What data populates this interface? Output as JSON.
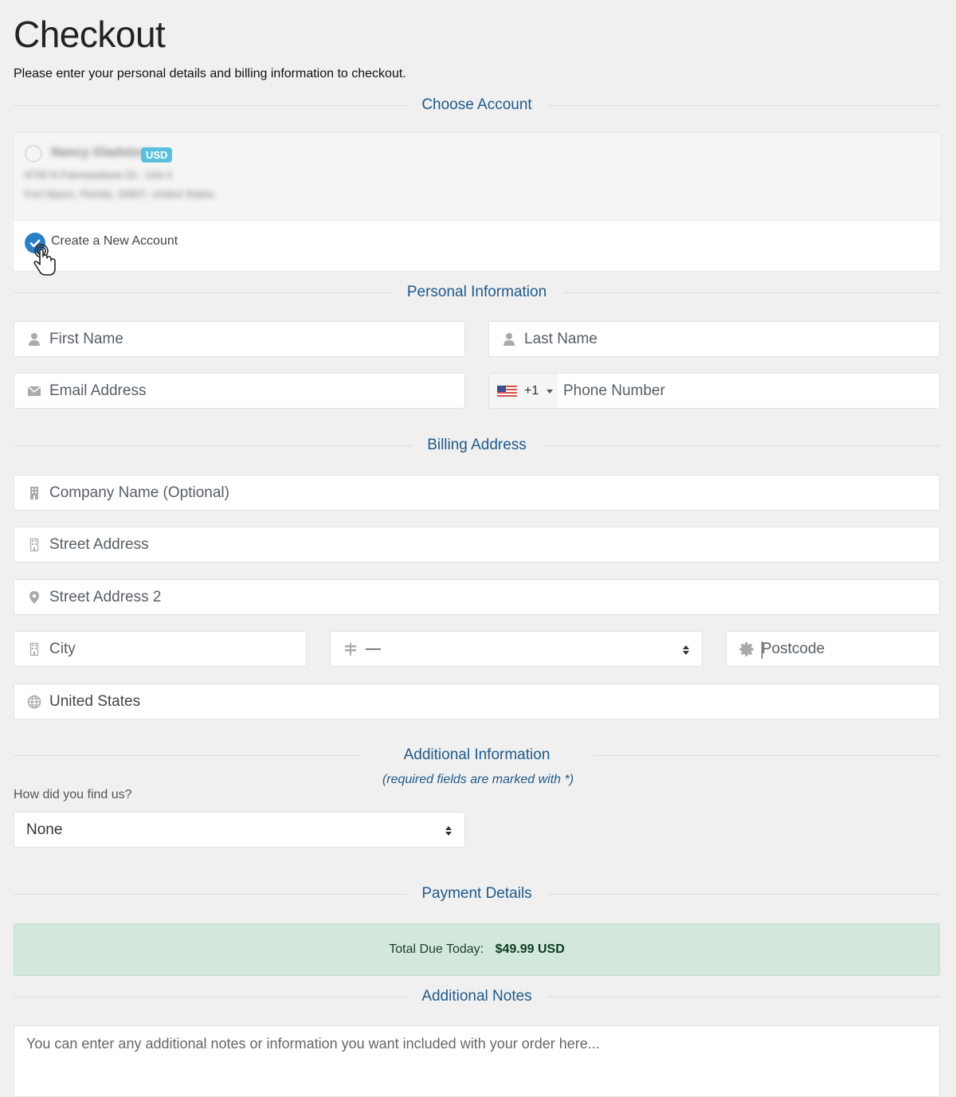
{
  "page": {
    "title": "Checkout",
    "subtitle": "Please enter your personal details and billing information to checkout."
  },
  "sections": {
    "choose_account": "Choose Account",
    "personal_info": "Personal Information",
    "billing_address": "Billing Address",
    "additional_info": "Additional Information",
    "payment_details": "Payment Details",
    "additional_notes": "Additional Notes"
  },
  "accounts": {
    "existing": {
      "name": "Nancy Gladstone",
      "currency_badge": "USD",
      "address_line1": "9755 N Fairmeadows Dr., Unit 4",
      "address_line2": "Fort Myers, Florida, 33907, United States",
      "selected": false
    },
    "new_account": {
      "label": "Create a New Account",
      "selected": true
    }
  },
  "personal": {
    "first_name_placeholder": "First Name",
    "last_name_placeholder": "Last Name",
    "email_placeholder": "Email Address",
    "phone_country_code": "+1",
    "phone_placeholder": "Phone Number"
  },
  "billing": {
    "company_placeholder": "Company Name (Optional)",
    "street_placeholder": "Street Address",
    "street2_placeholder": "Street Address 2",
    "city_placeholder": "City",
    "state_value": "—",
    "postcode_placeholder": "Postcode",
    "country_value": "United States"
  },
  "additional": {
    "required_note": "(required fields are marked with *)",
    "find_us_label": "How did you find us?",
    "find_us_value": "None"
  },
  "payment": {
    "total_label": "Total Due Today:",
    "total_value": "$49.99 USD"
  },
  "notes": {
    "placeholder": "You can enter any additional notes or information you want included with your order here..."
  },
  "colors": {
    "accent_blue": "#1f5a8b",
    "checked_blue": "#2a7fc8",
    "badge_cyan": "#5bc0de",
    "success_bg": "#d3e8dd"
  }
}
